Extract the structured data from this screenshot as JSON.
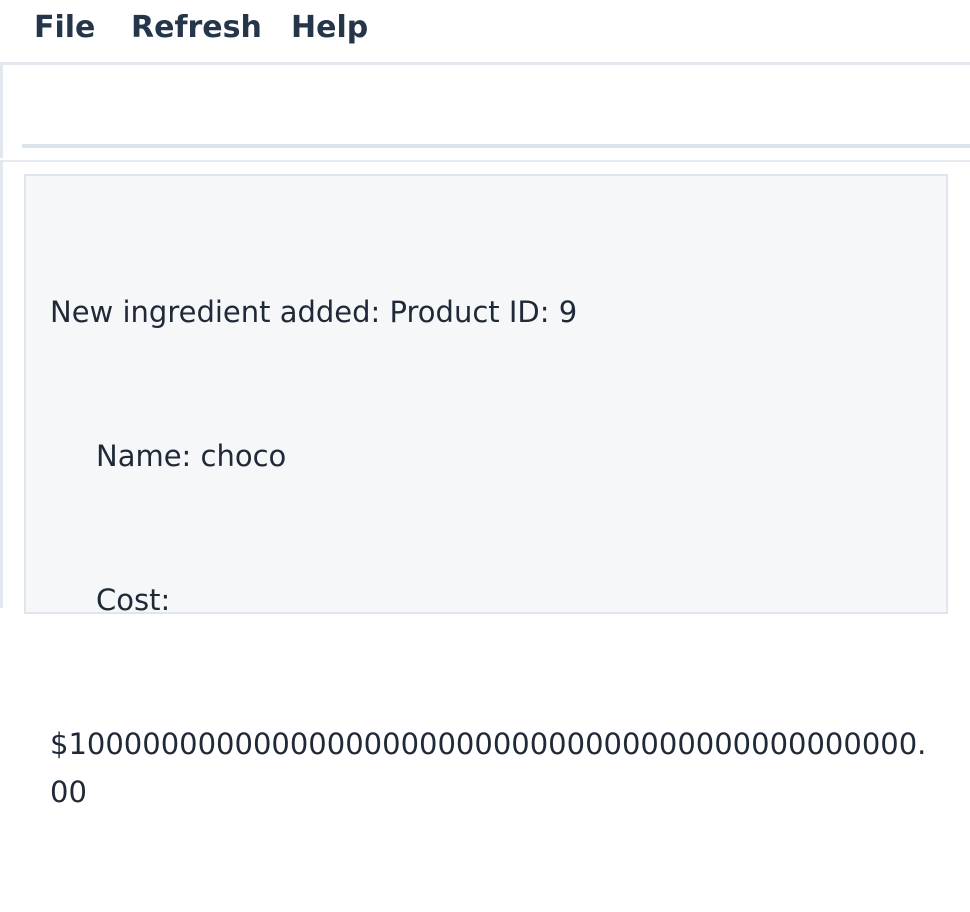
{
  "menubar": {
    "items": [
      "File",
      "Refresh",
      "Help"
    ]
  },
  "log": {
    "line1": "New ingredient added: Product ID: 9",
    "line2": "Name: choco",
    "line3": "Cost:",
    "line4": "$1000000000000000000000000000000000000000000000.00"
  },
  "colors": {
    "menu_text": "#25354a",
    "panel_bg": "#f5f7f9",
    "border": "#e1e6ec"
  }
}
